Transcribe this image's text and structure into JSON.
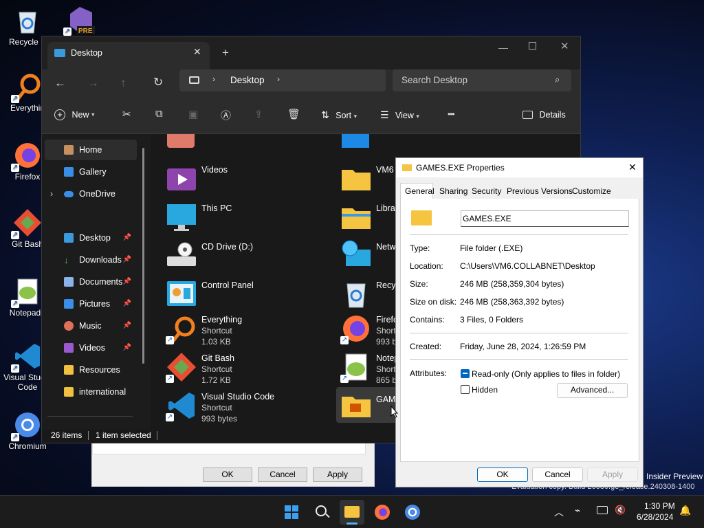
{
  "desktop": {
    "icons": [
      {
        "label": "Recycle B"
      },
      {
        "label": "PRE"
      },
      {
        "label": "Everythin"
      },
      {
        "label": "Firefox"
      },
      {
        "label": "Git Bash"
      },
      {
        "label": "Notepad+"
      },
      {
        "label": "Visual Studio Code"
      },
      {
        "label": "Chromium"
      }
    ],
    "watermark": {
      "line1": "Insider Preview",
      "line2": "Evaluation copy. Build 26080.ge_release.240308-1400"
    }
  },
  "back_dialog": {
    "ok": "OK",
    "cancel": "Cancel",
    "apply": "Apply"
  },
  "explorer": {
    "tab_title": "Desktop",
    "breadcrumb": "Desktop",
    "search_placeholder": "Search Desktop",
    "toolbar": {
      "new": "New",
      "sort": "Sort",
      "view": "View",
      "details": "Details",
      "more": "•••"
    },
    "nav": [
      {
        "label": "Home"
      },
      {
        "label": "Gallery"
      },
      {
        "label": "OneDrive"
      },
      {
        "label": "Desktop"
      },
      {
        "label": "Downloads"
      },
      {
        "label": "Documents"
      },
      {
        "label": "Pictures"
      },
      {
        "label": "Music"
      },
      {
        "label": "Videos"
      },
      {
        "label": "Resources"
      },
      {
        "label": "international"
      }
    ],
    "files_left": [
      {
        "name": "Videos"
      },
      {
        "name": "This PC"
      },
      {
        "name": "CD Drive (D:)"
      },
      {
        "name": "Control Panel"
      },
      {
        "name": "Everything",
        "type": "Shortcut",
        "size": "1.03 KB"
      },
      {
        "name": "Git Bash",
        "type": "Shortcut",
        "size": "1.72 KB"
      },
      {
        "name": "Visual Studio Code",
        "type": "Shortcut",
        "size": "993 bytes"
      }
    ],
    "files_right": [
      {
        "name": "VM6"
      },
      {
        "name": "Librar"
      },
      {
        "name": "Netwo"
      },
      {
        "name": "Recyc"
      },
      {
        "name": "Firefo",
        "type": "Shortc",
        "size": "993 by"
      },
      {
        "name": "Notep",
        "type": "Shortc",
        "size": "865 by"
      },
      {
        "name": "GAME"
      }
    ],
    "status": {
      "count": "26 items",
      "selected": "1 item selected"
    }
  },
  "properties": {
    "title": "GAMES.EXE Properties",
    "tabs": [
      "General",
      "Sharing",
      "Security",
      "Previous Versions",
      "Customize"
    ],
    "name_value": "GAMES.EXE",
    "type_label": "Type:",
    "type_value": "File folder (.EXE)",
    "location_label": "Location:",
    "location_value": "C:\\Users\\VM6.COLLABNET\\Desktop",
    "size_label": "Size:",
    "size_value": "246 MB (258,359,304 bytes)",
    "sod_label": "Size on disk:",
    "sod_value": "246 MB (258,363,392 bytes)",
    "contains_label": "Contains:",
    "contains_value": "3 Files, 0 Folders",
    "created_label": "Created:",
    "created_value": "Friday, June 28, 2024, 1:26:59 PM",
    "attributes_label": "Attributes:",
    "readonly_label": "Read-only (Only applies to files in folder)",
    "hidden_label": "Hidden",
    "advanced": "Advanced...",
    "ok": "OK",
    "cancel": "Cancel",
    "apply": "Apply"
  },
  "taskbar": {
    "time": "1:30 PM",
    "date": "6/28/2024"
  }
}
